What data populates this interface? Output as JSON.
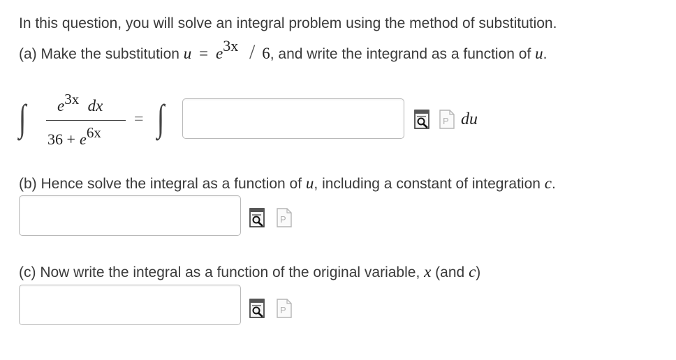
{
  "intro": {
    "line1": "In this question, you will solve an integral problem using the method of substitution."
  },
  "part_a": {
    "prefix": "(a) Make the substitution",
    "var_u": "u",
    "equals": "=",
    "base_e": "e",
    "exp_3x": "3x",
    "slash": "/",
    "six": "6",
    "suffix": ", and write the integrand as a function of",
    "suffix_var": "u",
    "suffix_end": "."
  },
  "integral": {
    "numerator_base": "e",
    "numerator_exp": "3x",
    "numerator_dx": "dx",
    "denominator_lead": "36 +",
    "denominator_base": "e",
    "denominator_exp": "6x",
    "integral_sign": "∫",
    "equals": "=",
    "du_label": "du",
    "answer_value": ""
  },
  "part_b": {
    "prefix": "(b) Hence solve the integral as a function of",
    "var_u": "u",
    "middle": ", including a constant of integration",
    "var_c": "c",
    "end": ".",
    "answer_value": ""
  },
  "part_c": {
    "prefix": "(c) Now write the integral as a function of the original variable,",
    "var_x": "x",
    "open": " (and",
    "var_c": "c",
    "close": ")",
    "answer_value": ""
  },
  "icons": {
    "preview": "preview-magnifier-icon",
    "palette": "formula-palette-icon"
  },
  "colors": {
    "text": "#3a3a3a",
    "input_border": "#b9b9b9"
  }
}
